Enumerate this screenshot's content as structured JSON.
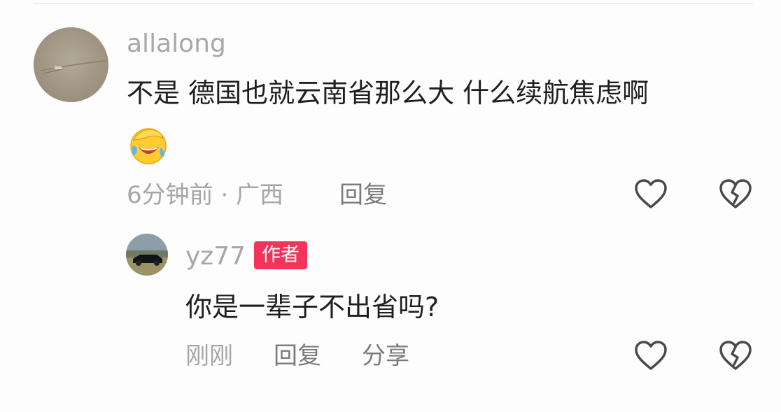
{
  "colors": {
    "text": "#1f1f1f",
    "meta": "#a6a6a6",
    "action": "#7c7c7c",
    "author_badge": "#f2345b",
    "icon": "#4a4a4a"
  },
  "comment": {
    "username": "allalong",
    "text": "不是   德国也就云南省那么大  什么续航焦虑啊",
    "emoji_icon": "face-with-tears-of-joy-icon",
    "meta": "6分钟前 · 广西",
    "reply_label": "回复",
    "like_icon": "heart-outline-icon",
    "dislike_icon": "broken-heart-icon"
  },
  "reply": {
    "username": "yz77",
    "badge": "作者",
    "text": "你是一辈子不出省吗?",
    "time": "刚刚",
    "reply_label": "回复",
    "share_label": "分享",
    "like_icon": "heart-outline-icon",
    "dislike_icon": "broken-heart-icon"
  }
}
